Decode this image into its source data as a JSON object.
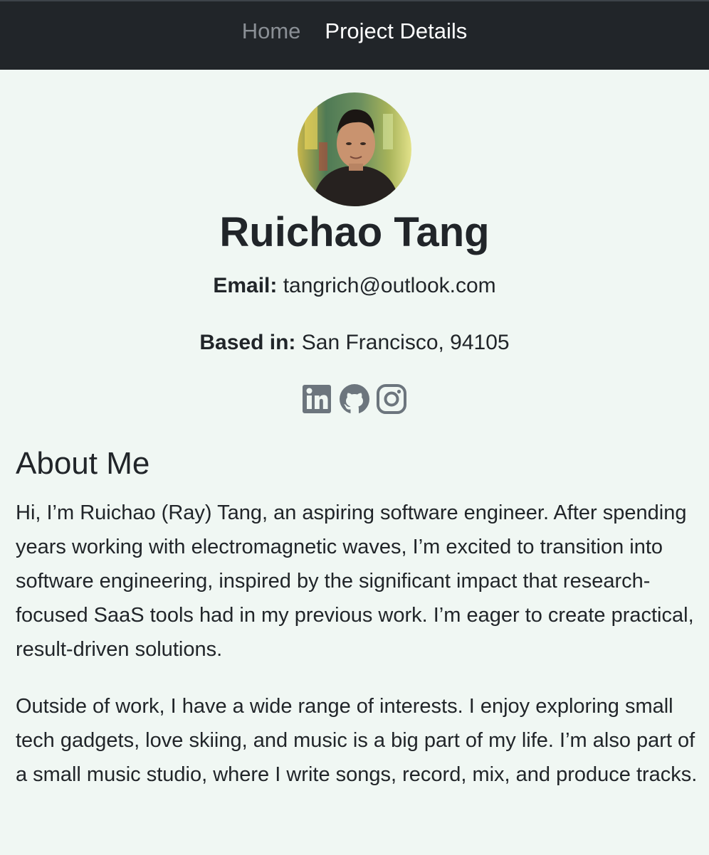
{
  "nav": {
    "items": [
      {
        "label": "Home",
        "active": false
      },
      {
        "label": "Project Details",
        "active": true
      }
    ]
  },
  "profile": {
    "name": "Ruichao Tang",
    "email_label": "Email:",
    "email": "tangrich@outlook.com",
    "location_label": "Based in:",
    "location": "San Francisco, 94105",
    "socials": [
      "linkedin-icon",
      "github-icon",
      "instagram-icon"
    ]
  },
  "about": {
    "title": "About Me",
    "paragraphs": [
      "Hi, I’m Ruichao (Ray) Tang, an aspiring software engineer. After spending years working with electromagnetic waves, I’m excited to transition into software engineering, inspired by the significant impact that research-focused SaaS tools had in my previous work. I’m eager to create practical, result-driven solutions.",
      "Outside of work, I have a wide range of interests. I enjoy exploring small tech gadgets, love skiing, and music is a big part of my life. I’m also part of a small music studio, where I write songs, record, mix, and produce tracks."
    ]
  },
  "colors": {
    "navbar": "#212529",
    "background": "#f0f7f3",
    "text": "#212529",
    "icon": "#6c757d"
  }
}
